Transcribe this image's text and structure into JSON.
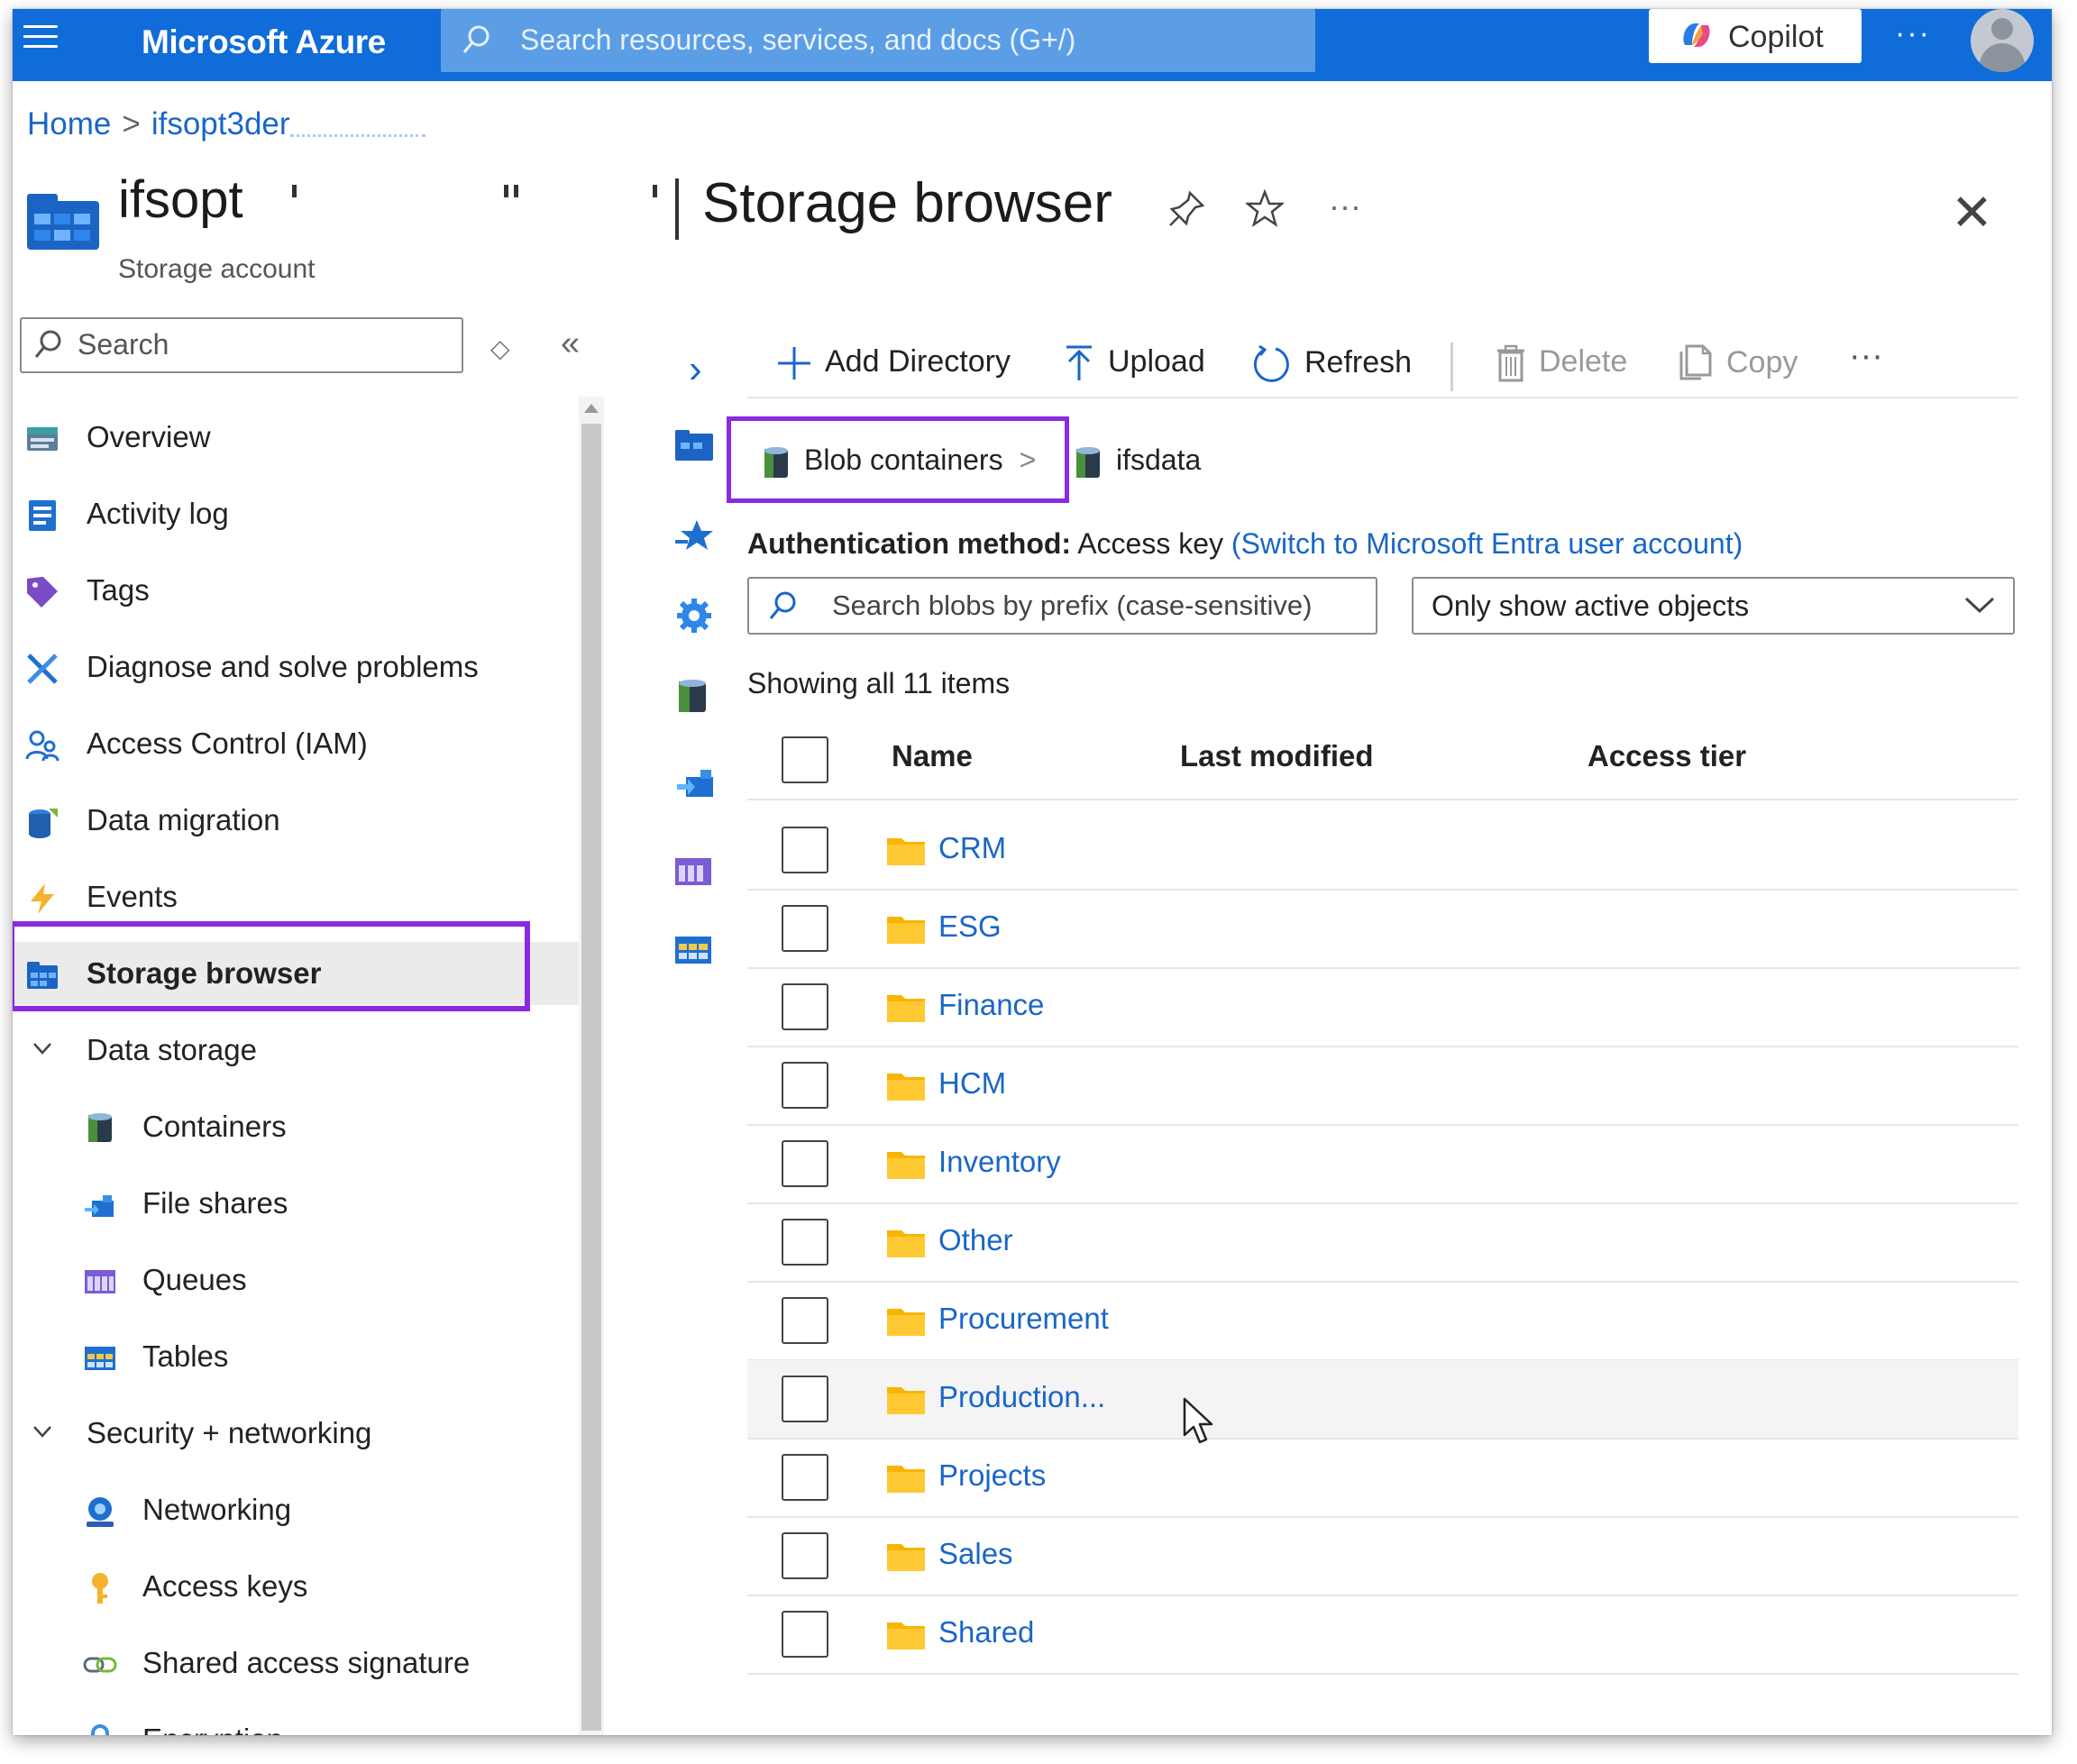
{
  "topbar": {
    "brand": "Microsoft Azure",
    "search_placeholder": "Search resources, services, and docs (G+/)",
    "copilot_label": "Copilot",
    "more_label": "···"
  },
  "breadcrumb": {
    "home": "Home",
    "resource": "ifsopt3der"
  },
  "header": {
    "resource_name": "ifsopt",
    "resource_type": "Storage account",
    "page_title": "Storage browser"
  },
  "nav": {
    "search_placeholder": "Search",
    "items": [
      {
        "label": "Overview",
        "icon": "overview-icon"
      },
      {
        "label": "Activity log",
        "icon": "activity-log-icon"
      },
      {
        "label": "Tags",
        "icon": "tag-icon"
      },
      {
        "label": "Diagnose and solve problems",
        "icon": "diagnose-icon"
      },
      {
        "label": "Access Control (IAM)",
        "icon": "iam-icon"
      },
      {
        "label": "Data migration",
        "icon": "data-migration-icon"
      },
      {
        "label": "Events",
        "icon": "events-icon"
      },
      {
        "label": "Storage browser",
        "icon": "storage-browser-icon"
      }
    ],
    "groups": [
      {
        "label": "Data storage",
        "items": [
          {
            "label": "Containers",
            "icon": "containers-icon"
          },
          {
            "label": "File shares",
            "icon": "file-shares-icon"
          },
          {
            "label": "Queues",
            "icon": "queues-icon"
          },
          {
            "label": "Tables",
            "icon": "tables-icon"
          }
        ]
      },
      {
        "label": "Security + networking",
        "items": [
          {
            "label": "Networking",
            "icon": "networking-icon"
          },
          {
            "label": "Access keys",
            "icon": "key-icon"
          },
          {
            "label": "Shared access signature",
            "icon": "link-icon"
          },
          {
            "label": "Encryption",
            "icon": "lock-icon"
          }
        ]
      }
    ]
  },
  "toolbar": {
    "add_directory": "Add Directory",
    "upload": "Upload",
    "refresh": "Refresh",
    "delete": "Delete",
    "copy": "Copy",
    "more": "···"
  },
  "path": {
    "root": "Blob containers",
    "current": "ifsdata"
  },
  "auth": {
    "label": "Authentication method:",
    "value": "Access key",
    "switch_link": "(Switch to Microsoft Entra user account)"
  },
  "filters": {
    "search_placeholder": "Search blobs by prefix (case-sensitive)",
    "dropdown_value": "Only show active objects"
  },
  "showing": "Showing all 11 items",
  "table": {
    "columns": [
      "Name",
      "Last modified",
      "Access tier"
    ],
    "rows": [
      "CRM",
      "ESG",
      "Finance",
      "HCM",
      "Inventory",
      "Other",
      "Procurement",
      "Production...",
      "Projects",
      "Sales",
      "Shared"
    ]
  },
  "colors": {
    "azure_blue": "#0f6cd8",
    "highlight_purple": "#8b2ae0",
    "link_blue": "#1a66c8",
    "folder_yellow": "#f7b500"
  }
}
